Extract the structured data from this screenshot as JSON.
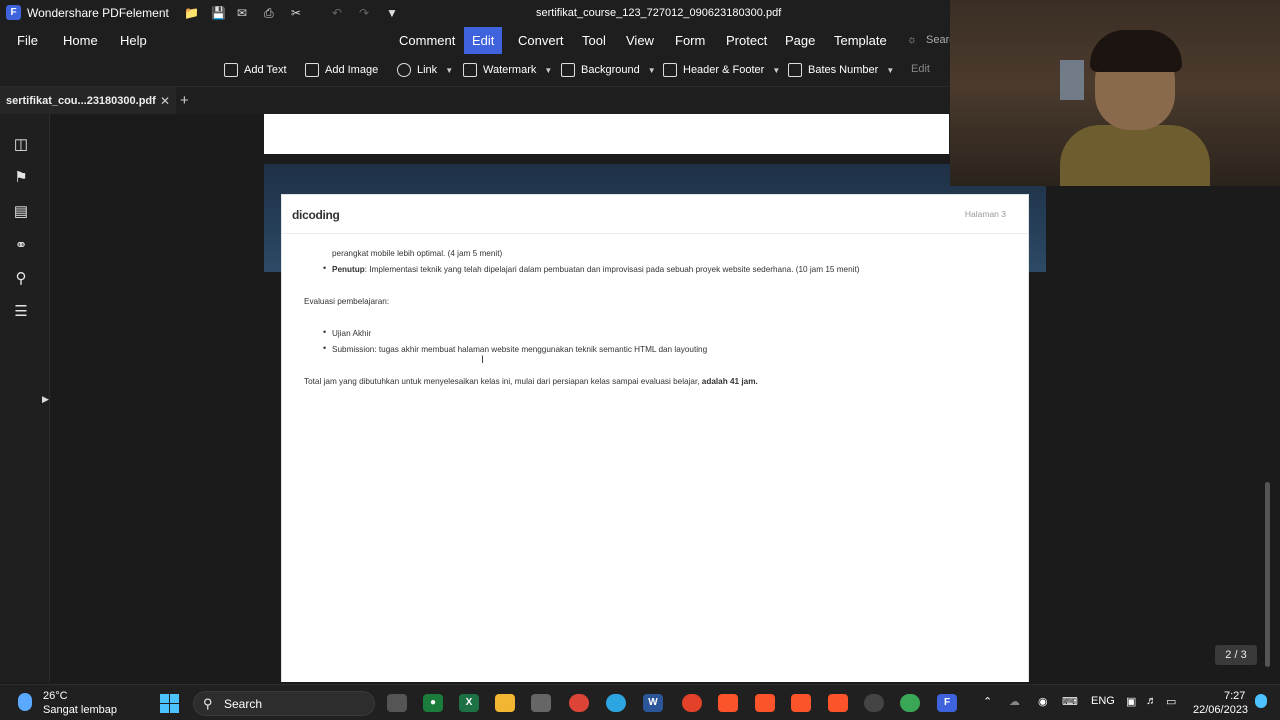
{
  "window": {
    "app_name": "Wondershare PDFelement",
    "doc_title": "sertifikat_course_123_727012_090623180300.pdf"
  },
  "menu": {
    "left": [
      "File",
      "Home",
      "Help"
    ],
    "center": [
      "Comment",
      "Edit",
      "Convert",
      "Tool",
      "View",
      "Form",
      "Protect",
      "Page",
      "Template"
    ],
    "active": "Edit",
    "search_label": "Searc"
  },
  "toolbar": {
    "items": [
      {
        "label": "Add Text",
        "icon": "text-box-icon"
      },
      {
        "label": "Add Image",
        "icon": "image-icon"
      },
      {
        "label": "Link",
        "icon": "link-icon"
      },
      {
        "label": "Watermark",
        "icon": "watermark-icon"
      },
      {
        "label": "Background",
        "icon": "background-icon"
      },
      {
        "label": "Header & Footer",
        "icon": "header-footer-icon"
      },
      {
        "label": "Bates Number",
        "icon": "bates-number-icon"
      }
    ],
    "edit_label": "Edit"
  },
  "tab": {
    "label": "sertifikat_cou...23180300.pdf"
  },
  "sidebar": {
    "icons": [
      "thumbnails-icon",
      "bookmark-icon",
      "comment-icon",
      "attachment-icon",
      "search-icon",
      "layers-icon"
    ]
  },
  "document": {
    "logo": "dicoding",
    "page_label": "Halaman 3",
    "lines": {
      "l1": "perangkat mobile lebih optimal. (4 jam 5 menit)",
      "l2_bold": "Penutup",
      "l2_rest": ": Implementasi teknik yang telah dipelajari dalam pembuatan dan improvisasi pada sebuah proyek website sederhana. (10 jam 15 menit)",
      "eval_heading": "Evaluasi pembelajaran:",
      "eval1": "Ujian Akhir",
      "eval2": "Submission: tugas akhir membuat halaman website menggunakan teknik semantic HTML dan layouting",
      "total_prefix": "Total jam yang dibutuhkan untuk menyelesaikan kelas ini, mulai dari persiapan kelas sampai evaluasi belajar, ",
      "total_bold": "adalah 41 jam."
    }
  },
  "page_counter": "2 / 3",
  "taskbar": {
    "temperature": "26°C",
    "condition": "Sangat lembap",
    "search_label": "Search",
    "language": "ENG",
    "time": "7:27",
    "date": "22/06/2023"
  }
}
